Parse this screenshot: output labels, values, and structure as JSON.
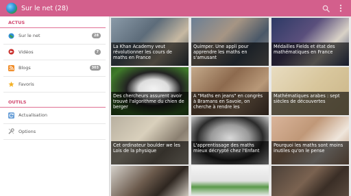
{
  "app": {
    "title": "Sur le net (28)"
  },
  "sidebar": {
    "sections": [
      {
        "title": "ACTUS",
        "items": [
          {
            "label": "Sur le net",
            "badge": "28",
            "icon": "globe-icon"
          },
          {
            "label": "Vidéos",
            "badge": "7",
            "icon": "video-icon"
          },
          {
            "label": "Blogs",
            "badge": "303",
            "icon": "rss-icon"
          },
          {
            "label": "Favoris",
            "badge": "",
            "icon": "star-icon"
          }
        ]
      },
      {
        "title": "OUTILS",
        "items": [
          {
            "label": "Actualisation",
            "icon": "refresh-icon"
          },
          {
            "label": "Options",
            "icon": "tools-icon"
          }
        ]
      }
    ]
  },
  "tiles": [
    {
      "caption": "La Khan Academy veut révolutionner les cours de maths en France"
    },
    {
      "caption": "Quimper. Une appli pour apprendre les maths en s'amusant"
    },
    {
      "caption": "Médailles Fields et état des mathématiques en France"
    },
    {
      "caption": "Des chercheurs assurent avoir trouvé l'algorithme du chien de berger"
    },
    {
      "caption": "A \"Maths en jeans\" en congrès à Bramans en Savoie, on cherche à rendre les"
    },
    {
      "caption": "Mathématiques arabes : sept siècles de découvertes"
    },
    {
      "caption": "Cet ordinateur boulder we les Lois de la physique"
    },
    {
      "caption": "L'apprentissage des maths mieux décrypté chez l'Enfant"
    },
    {
      "caption": "Pourquoi les maths sont moins inutiles qu'on le pense"
    },
    {
      "caption": ""
    },
    {
      "caption": ""
    },
    {
      "caption": ""
    }
  ],
  "colors": {
    "topbar": "#d35f8c",
    "section": "#d0456e"
  }
}
